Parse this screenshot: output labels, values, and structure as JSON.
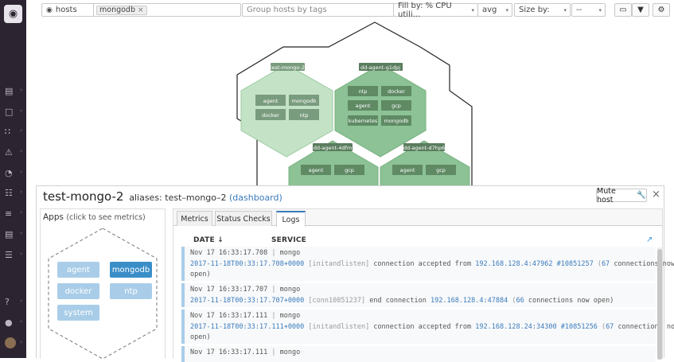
{
  "toolbar": {
    "mode": "hosts",
    "filter_tag": "mongodb",
    "group_placeholder": "Group hosts by tags",
    "fill_by": "Fill by: % CPU utili...",
    "fill_agg": "avg",
    "size_by": "Size by:",
    "size_val": "--"
  },
  "hexes": [
    {
      "name": "test-mongo-2",
      "apps": [
        "agent",
        "mongodb",
        "docker",
        "ntp"
      ]
    },
    {
      "name": "dd-agent-g1dpj",
      "apps": [
        "ntp",
        "docker",
        "agent",
        "gcp",
        "kubernetes",
        "mongodb"
      ]
    },
    {
      "name": "dd-agent-4dfm",
      "apps": [
        "agent",
        "gcp"
      ]
    },
    {
      "name": "dd-agent-d7hp6",
      "apps": [
        "agent",
        "gcp"
      ]
    }
  ],
  "panel": {
    "host": "test-mongo-2",
    "aliases_label": "aliases: test–mongo–2",
    "dashboard_link": "(dashboard)",
    "mute_label": "Mute host",
    "apps_title": "Apps",
    "apps_hint": "(click to see metrics)",
    "apps": [
      {
        "label": "agent",
        "selected": false
      },
      {
        "label": "mongodb",
        "selected": true
      },
      {
        "label": "docker",
        "selected": false
      },
      {
        "label": "ntp",
        "selected": false
      },
      {
        "label": "system",
        "selected": false
      }
    ],
    "tabs": [
      "Metrics",
      "Status Checks",
      "Logs"
    ],
    "active_tab": "Logs",
    "col_date": "DATE ↓",
    "col_service": "SERVICE"
  },
  "logs": [
    {
      "date": "Nov 17 16:33:17.708",
      "service": "mongo",
      "ts": "2017-11-18T00:33:17.708+0000",
      "ctx": "[initandlisten]",
      "msg": "connection accepted from",
      "ip": "192.168.128.4:47962",
      "id": "#10851257",
      "count": "67",
      "tail": "connections now",
      "tail2": "open)"
    },
    {
      "date": "Nov 17 16:33:17.707",
      "service": "mongo",
      "ts": "2017-11-18T00:33:17.707+0000",
      "ctx": "[conn10851237]",
      "msg": "end connection",
      "ip": "192.168.128.4:47884",
      "id": "",
      "count": "66",
      "tail": "connections now open)",
      "tail2": ""
    },
    {
      "date": "Nov 17 16:33:17.111",
      "service": "mongo",
      "ts": "2017-11-18T00:33:17.111+0000",
      "ctx": "[initandlisten]",
      "msg": "connection accepted from",
      "ip": "192.168.128.24:34300",
      "id": "#10851256",
      "count": "67",
      "tail": "connections now",
      "tail2": "open)"
    },
    {
      "date": "Nov 17 16:33:17.111",
      "service": "mongo",
      "ts": "",
      "ctx": "",
      "msg": "",
      "ip": "",
      "id": "",
      "count": "",
      "tail": "",
      "tail2": ""
    }
  ],
  "colors": {
    "hex_light": "#c4e3c6",
    "hex_dark": "#8cc295",
    "app_selected": "#3a8ec8",
    "app": "#a9cde8"
  }
}
